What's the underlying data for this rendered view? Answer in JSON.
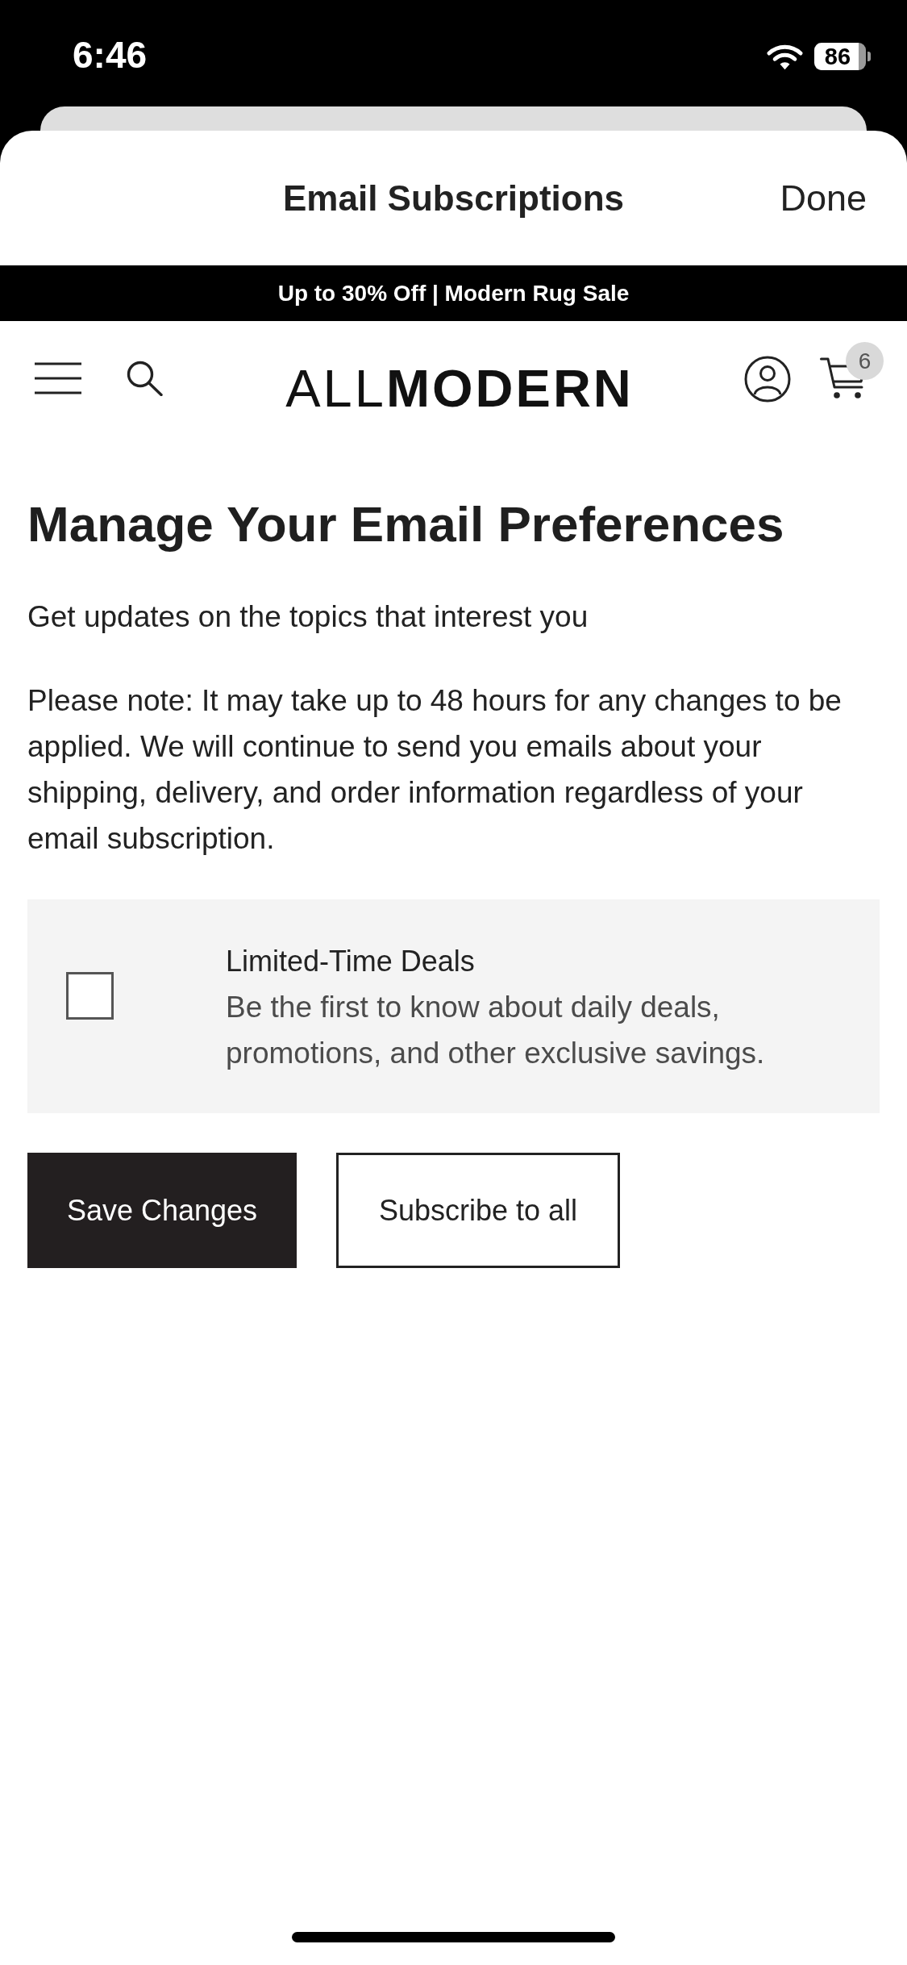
{
  "status_bar": {
    "time": "6:46",
    "battery": "86"
  },
  "sheet": {
    "title": "Email Subscriptions",
    "done": "Done"
  },
  "promo_banner": "Up to 30% Off | Modern Rug Sale",
  "header": {
    "logo": "ALL**MODERN**",
    "cart_count": "6"
  },
  "page": {
    "heading": "Manage Your Email Preferences",
    "intro": "Get updates on the topics that interest you",
    "note": "Please note: It may take up to 48 hours for any changes to be applied. We will continue to send you emails about your shipping, delivery, and order information regardless of your email subscription."
  },
  "subscriptions": [
    {
      "title": "Limited-Time Deals",
      "description": "Be the first to know about daily deals, promotions, and other exclusive savings.",
      "checked": false
    }
  ],
  "buttons": [
    {
      "label": "Save Changes",
      "kind": "primary"
    },
    {
      "label": "Subscribe to all",
      "kind": "secondary"
    }
  ]
}
